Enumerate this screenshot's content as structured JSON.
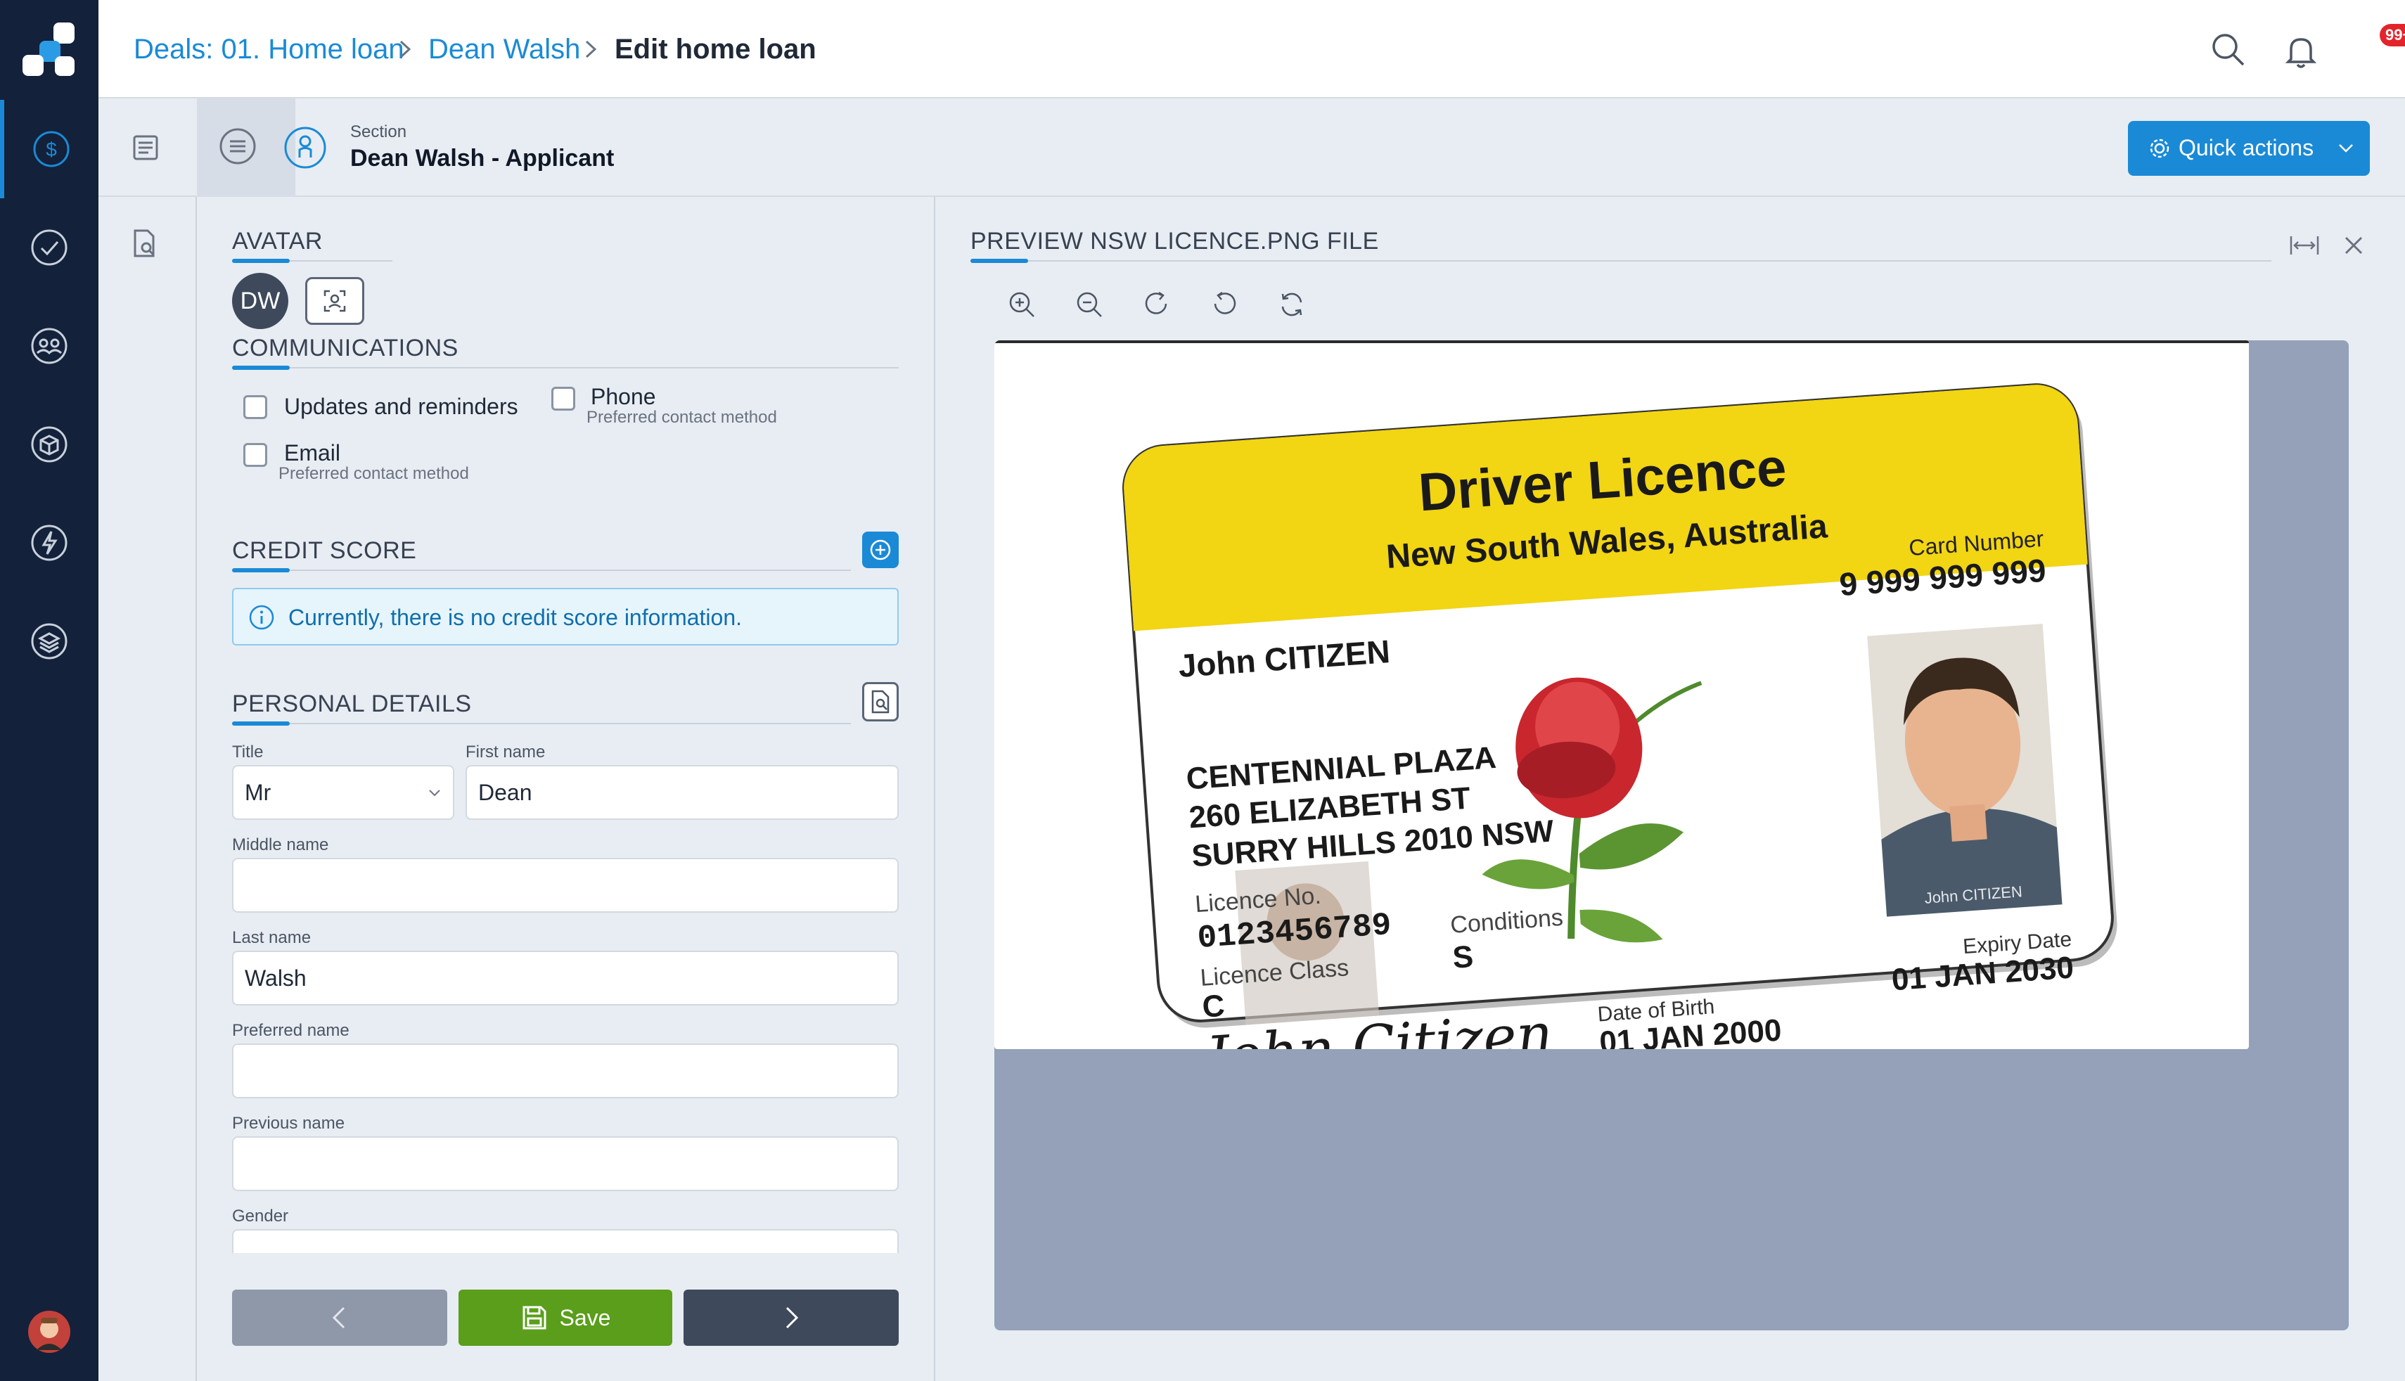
{
  "breadcrumb": {
    "items": [
      "Deals: 01. Home loan",
      "Dean Walsh"
    ],
    "current": "Edit home loan"
  },
  "header": {
    "notification_badge": "99+"
  },
  "section": {
    "label": "Section",
    "title": "Dean Walsh - Applicant"
  },
  "quick_actions": {
    "label": "Quick actions"
  },
  "avatar": {
    "title": "AVATAR",
    "initials": "DW"
  },
  "communications": {
    "title": "COMMUNICATIONS",
    "updates_label": "Updates and reminders",
    "phone_label": "Phone",
    "phone_sub": "Preferred contact method",
    "email_label": "Email",
    "email_sub": "Preferred contact method"
  },
  "credit_score": {
    "title": "CREDIT SCORE",
    "info": "Currently, there is no credit score information."
  },
  "personal_details": {
    "title": "PERSONAL DETAILS",
    "title_label": "Title",
    "title_value": "Mr",
    "first_name_label": "First name",
    "first_name_value": "Dean",
    "middle_name_label": "Middle name",
    "middle_name_value": "",
    "last_name_label": "Last name",
    "last_name_value": "Walsh",
    "preferred_name_label": "Preferred name",
    "preferred_name_value": "",
    "previous_name_label": "Previous name",
    "previous_name_value": "",
    "gender_label": "Gender"
  },
  "footer": {
    "save_label": "Save"
  },
  "preview": {
    "title": "PREVIEW NSW LICENCE.PNG FILE"
  },
  "licence": {
    "header_title": "Driver Licence",
    "header_sub": "New South Wales, Australia",
    "name": "John CITIZEN",
    "card_number_label": "Card Number",
    "card_number": "9 999 999 999",
    "address_1": "CENTENNIAL PLAZA",
    "address_2": "260 ELIZABETH ST",
    "address_3": "SURRY HILLS 2010 NSW",
    "licence_no_label": "Licence No.",
    "licence_no": "0123456789",
    "licence_class_label": "Licence Class",
    "licence_class": "C",
    "conditions_label": "Conditions",
    "conditions": "S",
    "signature": "John Citizen",
    "dob_label": "Date of Birth",
    "dob": "01 JAN 2000",
    "expiry_label": "Expiry Date",
    "expiry": "01 JAN 2030",
    "photo_caption": "John CITIZEN"
  },
  "colors": {
    "accent": "#1a8ad6",
    "rail": "#13213a",
    "save": "#5a9e1b",
    "licence_yellow": "#f2d513"
  }
}
